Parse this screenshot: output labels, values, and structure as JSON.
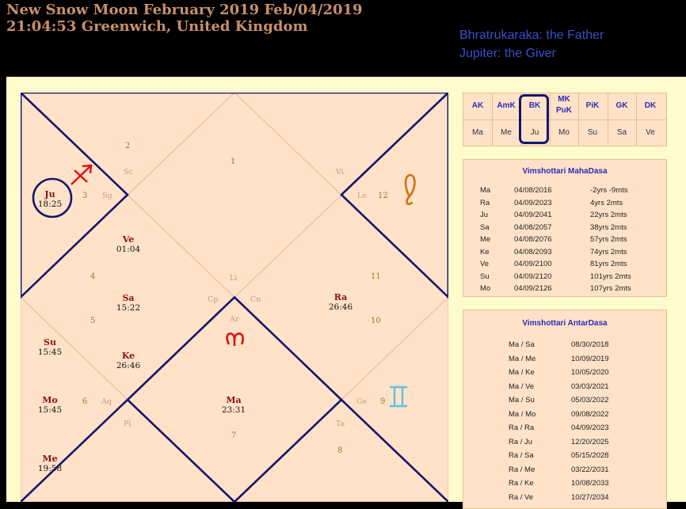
{
  "header": {
    "title": "New Snow Moon February 2019  Feb/04/2019  21:04:53  Greenwich, United Kingdom",
    "subtitle_lines": [
      "Bhratrukaraka: the Father",
      "Jupiter: the Giver"
    ]
  },
  "karakas": [
    {
      "label": "AK",
      "value": "Ma"
    },
    {
      "label": "AmK",
      "value": "Me"
    },
    {
      "label": "BK",
      "value": "Ju"
    },
    {
      "label": "MK\nPuK",
      "value": "Mo"
    },
    {
      "label": "PiK",
      "value": "Su"
    },
    {
      "label": "GK",
      "value": "Sa"
    },
    {
      "label": "DK",
      "value": "Ve"
    }
  ],
  "mahadasa": {
    "title": "Vimshottari MahaDasa",
    "rows": [
      {
        "planet": "Ma",
        "date": "04/08/2016",
        "age": "-2yrs -9mts"
      },
      {
        "planet": "Ra",
        "date": "04/09/2023",
        "age": "4yrs 2mts"
      },
      {
        "planet": "Ju",
        "date": "04/09/2041",
        "age": "22yrs 2mts"
      },
      {
        "planet": "Sa",
        "date": "04/08/2057",
        "age": "38yrs 2mts"
      },
      {
        "planet": "Me",
        "date": "04/08/2076",
        "age": "57yrs 2mts"
      },
      {
        "planet": "Ke",
        "date": "04/08/2093",
        "age": "74yrs 2mts"
      },
      {
        "planet": "Ve",
        "date": "04/09/2100",
        "age": "81yrs 2mts"
      },
      {
        "planet": "Su",
        "date": "04/09/2120",
        "age": "101yrs 2mts"
      },
      {
        "planet": "Mo",
        "date": "04/09/2126",
        "age": "107yrs 2mts"
      }
    ]
  },
  "antardasa": {
    "title": "Vimshottari AntarDasa",
    "rows": [
      {
        "period": "Ma / Sa",
        "date": "08/30/2018"
      },
      {
        "period": "Ma / Me",
        "date": "10/09/2019"
      },
      {
        "period": "Ma / Ke",
        "date": "10/05/2020"
      },
      {
        "period": "Ma / Ve",
        "date": "03/03/2021"
      },
      {
        "period": "Ma / Su",
        "date": "05/03/2022"
      },
      {
        "period": "Ma / Mo",
        "date": "09/08/2022"
      },
      {
        "period": "Ra / Ra",
        "date": "04/09/2023"
      },
      {
        "period": "Ra / Ju",
        "date": "12/20/2025"
      },
      {
        "period": "Ra / Sa",
        "date": "05/15/2028"
      },
      {
        "period": "Ra / Me",
        "date": "03/22/2031"
      },
      {
        "period": "Ra / Ke",
        "date": "10/08/2033"
      },
      {
        "period": "Ra / Ve",
        "date": "10/27/2034"
      }
    ]
  },
  "chart": {
    "houses": [
      "1",
      "2",
      "3",
      "4",
      "5",
      "6",
      "7",
      "8",
      "9",
      "10",
      "11",
      "12"
    ],
    "signs": [
      "Sc",
      "Sg",
      "Vi",
      "Le",
      "Li",
      "Cp",
      "Cn",
      "Ar",
      "Aq",
      "Pi",
      "Ge",
      "Ta"
    ],
    "planets": [
      {
        "name": "Ju",
        "deg": "18:25"
      },
      {
        "name": "Ve",
        "deg": "01:04"
      },
      {
        "name": "Sa",
        "deg": "15:22"
      },
      {
        "name": "Ra",
        "deg": "26:46"
      },
      {
        "name": "Su",
        "deg": "15:45"
      },
      {
        "name": "Ke",
        "deg": "26:46"
      },
      {
        "name": "Mo",
        "deg": "15:45"
      },
      {
        "name": "Ma",
        "deg": "23:31"
      },
      {
        "name": "Me",
        "deg": "19:58"
      }
    ],
    "annotation_colors": {
      "outline": "#14146e",
      "sagittarius": "#e01010",
      "leo": "#d07010",
      "aries": "#e01010",
      "gemini": "#60c0e0"
    }
  }
}
